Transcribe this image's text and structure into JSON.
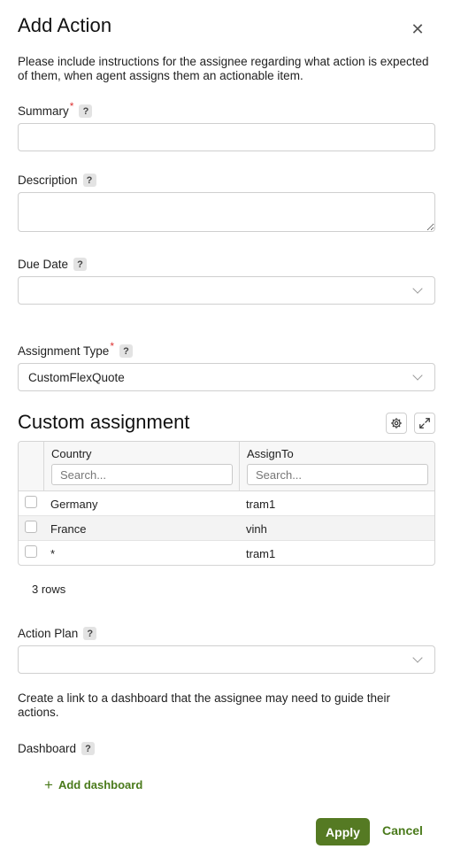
{
  "dialog": {
    "title": "Add Action",
    "close_icon": "close-icon",
    "intro": "Please include instructions for the assignee regarding what action is expected of them, when agent assigns them an actionable item."
  },
  "fields": {
    "summary": {
      "label": "Summary",
      "required": "*",
      "help": "?",
      "value": ""
    },
    "description": {
      "label": "Description",
      "help": "?",
      "value": ""
    },
    "due_date": {
      "label": "Due Date",
      "help": "?",
      "value": ""
    },
    "assignment_type": {
      "label": "Assignment Type",
      "required": "*",
      "help": "?",
      "value": "CustomFlexQuote"
    }
  },
  "custom_assignment": {
    "title": "Custom assignment",
    "settings_icon": "gear-icon",
    "expand_icon": "expand-icon",
    "columns": [
      {
        "name": "Country",
        "filter_placeholder": "Search..."
      },
      {
        "name": "AssignTo",
        "filter_placeholder": "Search..."
      }
    ],
    "rows": [
      {
        "country": "Germany",
        "assign_to": "tram1"
      },
      {
        "country": "France",
        "assign_to": "vinh"
      },
      {
        "country": "*",
        "assign_to": "tram1"
      }
    ],
    "row_count": "3 rows"
  },
  "action_plan": {
    "label": "Action Plan",
    "help": "?",
    "value": ""
  },
  "dashboard": {
    "note": "Create a link to a dashboard that the assignee may need to guide their actions.",
    "label": "Dashboard",
    "help": "?",
    "add_label": "Add dashboard",
    "add_icon": "plus-icon"
  },
  "footer": {
    "apply": "Apply",
    "cancel": "Cancel"
  },
  "colors": {
    "accent": "#557a23",
    "link": "#4a7a1b",
    "required": "#dd3333"
  }
}
